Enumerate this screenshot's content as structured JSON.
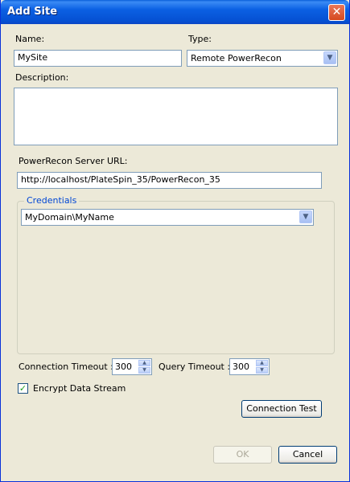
{
  "window": {
    "title": "Add Site",
    "close_label": "✕"
  },
  "form": {
    "name_label": "Name:",
    "name_value": "MySite",
    "type_label": "Type:",
    "type_value": "Remote PowerRecon",
    "description_label": "Description:",
    "description_value": "",
    "server_url_label": "PowerRecon Server URL:",
    "server_url_value": "http://localhost/PlateSpin_35/PowerRecon_35",
    "credentials_label": "Credentials",
    "credentials_value": "MyDomain\\MyName",
    "connection_timeout_label": "Connection Timeout :",
    "connection_timeout_value": "300",
    "query_timeout_label": "Query Timeout :",
    "query_timeout_value": "300",
    "encrypt_label": "Encrypt Data Stream",
    "encrypt_checked": true
  },
  "buttons": {
    "connection_test": "Connection Test",
    "ok": "OK",
    "cancel": "Cancel"
  },
  "icons": {
    "dropdown": "chevron-down-icon",
    "spin_up": "spin-up-icon",
    "spin_down": "spin-down-icon",
    "check": "checkmark-icon",
    "close": "close-icon"
  }
}
